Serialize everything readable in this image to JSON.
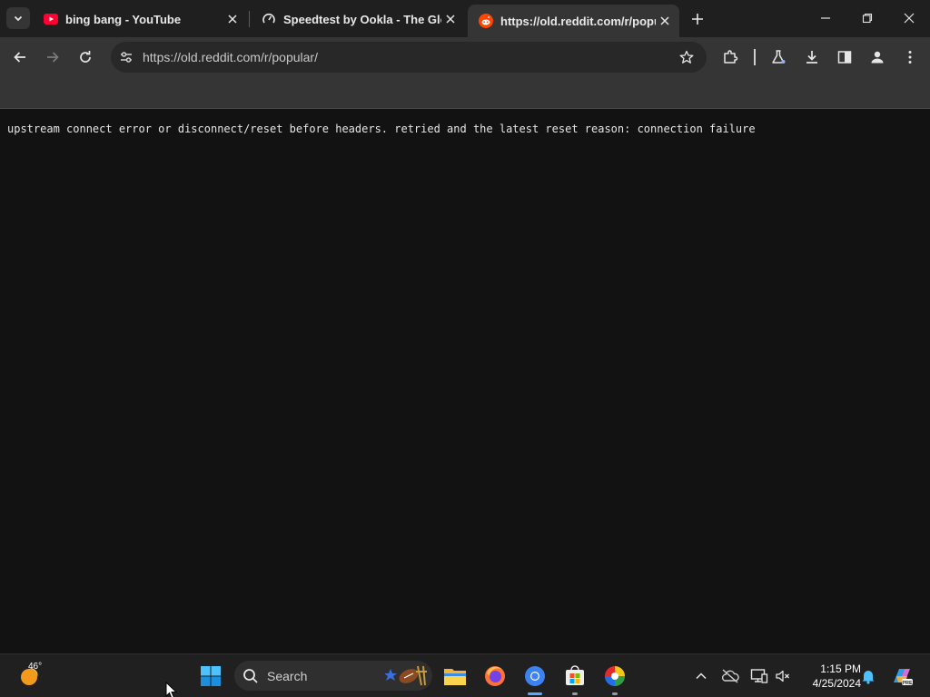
{
  "browser": {
    "tabs": [
      {
        "title": "bing bang - YouTube",
        "favicon": "youtube-icon",
        "active": false
      },
      {
        "title": "Speedtest by Ookla - The Global Broadband Speed Test",
        "favicon": "speedtest-icon",
        "active": false
      },
      {
        "title": "https://old.reddit.com/r/popular/",
        "favicon": "reddit-icon",
        "active": true
      }
    ],
    "address_bar": {
      "url": "https://old.reddit.com/r/popular/"
    },
    "colors": {
      "frame": "#1f1f1f",
      "toolbar": "#353535",
      "omnibox": "#282828",
      "page_bg": "#121212"
    }
  },
  "page": {
    "error_text": "upstream connect error or disconnect/reset before headers. retried and the latest reset reason: connection failure"
  },
  "taskbar": {
    "weather_temp": "46°",
    "search_label": "Search",
    "clock_time": "1:15 PM",
    "clock_date": "4/25/2024",
    "pinned": [
      "file-explorer-icon",
      "firefox-icon",
      "chrome-icon",
      "microsoft-store-icon",
      "game-app-icon"
    ],
    "accent": "#5ea6ff"
  }
}
